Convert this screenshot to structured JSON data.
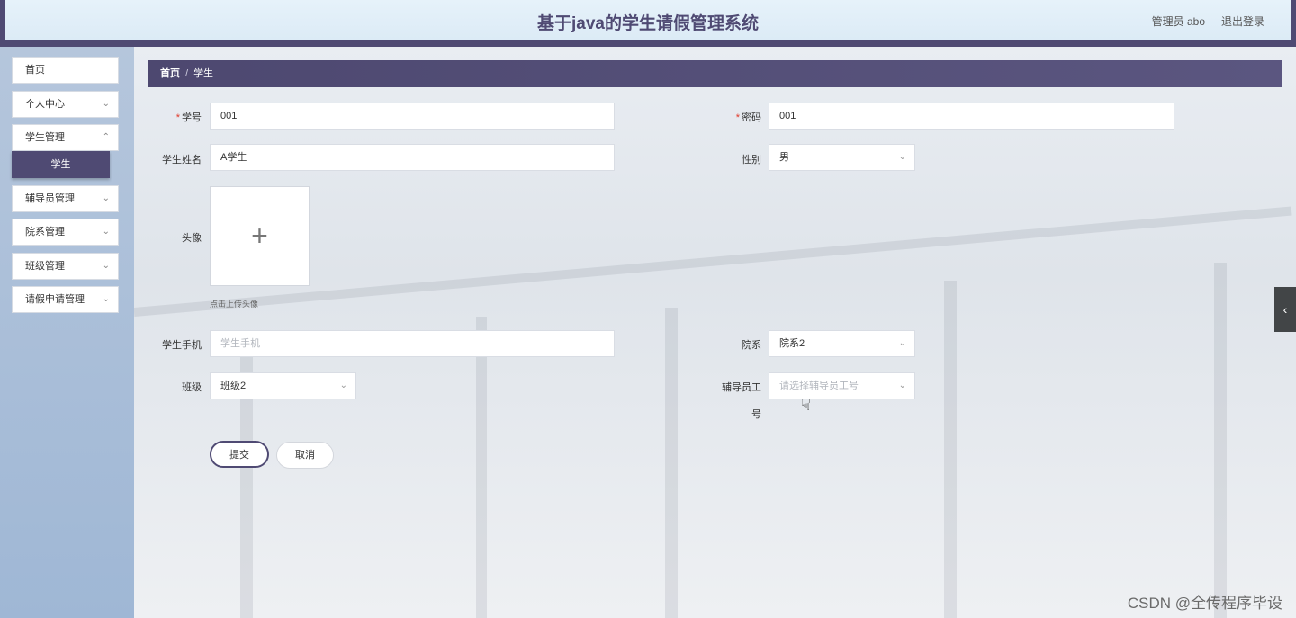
{
  "header": {
    "title": "基于java的学生请假管理系统",
    "user_label": "管理员 abo",
    "logout_label": "退出登录"
  },
  "sidebar": {
    "items": [
      {
        "label": "首页",
        "expandable": false
      },
      {
        "label": "个人中心",
        "expandable": true
      },
      {
        "label": "学生管理",
        "expandable": true
      },
      {
        "label": "辅导员管理",
        "expandable": true
      },
      {
        "label": "院系管理",
        "expandable": true
      },
      {
        "label": "班级管理",
        "expandable": true
      },
      {
        "label": "请假申请管理",
        "expandable": true
      }
    ],
    "active_subitem": "学生"
  },
  "breadcrumb": {
    "home": "首页",
    "separator": "/",
    "current": "学生"
  },
  "form": {
    "student_id": {
      "label": "学号",
      "required_mark": "*",
      "value": "001"
    },
    "password": {
      "label": "密码",
      "required_mark": "*",
      "value": "001"
    },
    "student_name": {
      "label": "学生姓名",
      "value": "A学生"
    },
    "gender": {
      "label": "性别",
      "value": "男"
    },
    "avatar": {
      "label": "头像",
      "upload_icon": "plus-icon",
      "hint": "点击上传头像"
    },
    "phone": {
      "label": "学生手机",
      "placeholder": "学生手机",
      "value": ""
    },
    "department": {
      "label": "院系",
      "value": "院系2"
    },
    "class": {
      "label": "班级",
      "value": "班级2"
    },
    "counselor_id": {
      "label_line1": "辅导员工",
      "label_line2": "号",
      "placeholder": "请选择辅导员工号"
    },
    "submit_label": "提交",
    "cancel_label": "取消"
  },
  "side_toggle_icon": "chevron-left-icon",
  "watermark": "CSDN @全传程序毕设",
  "colors": {
    "primary": "#4f4a73",
    "header_bg": "#e3f0f9",
    "sidebar_bg": "#a9bed9",
    "required": "#e0392b"
  }
}
